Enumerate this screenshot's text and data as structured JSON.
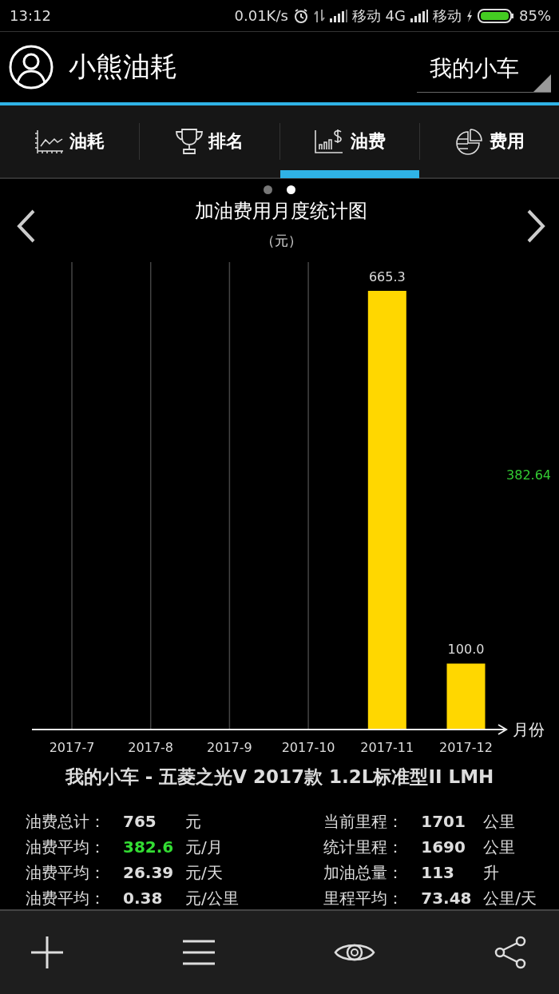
{
  "status_bar": {
    "time": "13:12",
    "net_speed": "0.01K/s",
    "carrier_1": "移动 4G",
    "carrier_2": "移动",
    "battery": "85%"
  },
  "header": {
    "title": "小熊油耗",
    "car_selector": "我的小车"
  },
  "tabs": [
    {
      "label": "油耗",
      "selected": false
    },
    {
      "label": "排名",
      "selected": false
    },
    {
      "label": "油费",
      "selected": true
    },
    {
      "label": "费用",
      "selected": false
    }
  ],
  "pager": [
    {
      "selected": false
    },
    {
      "selected": true
    }
  ],
  "chart": {
    "title": "加油费用月度统计图",
    "unit": "（元）",
    "average_label": "382.64",
    "chart_data": {
      "type": "bar",
      "xlabel": "月份",
      "categories": [
        "2017-7",
        "2017-8",
        "2017-9",
        "2017-10",
        "2017-11",
        "2017-12"
      ],
      "values": [
        null,
        null,
        null,
        null,
        665.3,
        100.0
      ],
      "value_labels": [
        null,
        null,
        null,
        null,
        "665.3",
        "100.0"
      ],
      "grid": true,
      "ylim": [
        0,
        665.3
      ]
    }
  },
  "car_name": "我的小车 - 五菱之光V 2017款 1.2L标准型II LMH",
  "stats_left": [
    {
      "label": "油费总计：",
      "value": "765",
      "unit": "元",
      "highlighted": false
    },
    {
      "label": "油费平均：",
      "value": "382.6",
      "unit": "元/月",
      "highlighted": true
    },
    {
      "label": "油费平均：",
      "value": "26.39",
      "unit": "元/天",
      "highlighted": false
    },
    {
      "label": "油费平均：",
      "value": "0.38",
      "unit": "元/公里",
      "highlighted": false
    }
  ],
  "stats_right": [
    {
      "label": "当前里程：",
      "value": "1701",
      "unit": "公里",
      "highlighted": false
    },
    {
      "label": "统计里程：",
      "value": "1690",
      "unit": "公里",
      "highlighted": false
    },
    {
      "label": "加油总量：",
      "value": "113",
      "unit": "升",
      "highlighted": false
    },
    {
      "label": "里程平均：",
      "value": "73.48",
      "unit": "公里/天",
      "highlighted": false
    }
  ]
}
